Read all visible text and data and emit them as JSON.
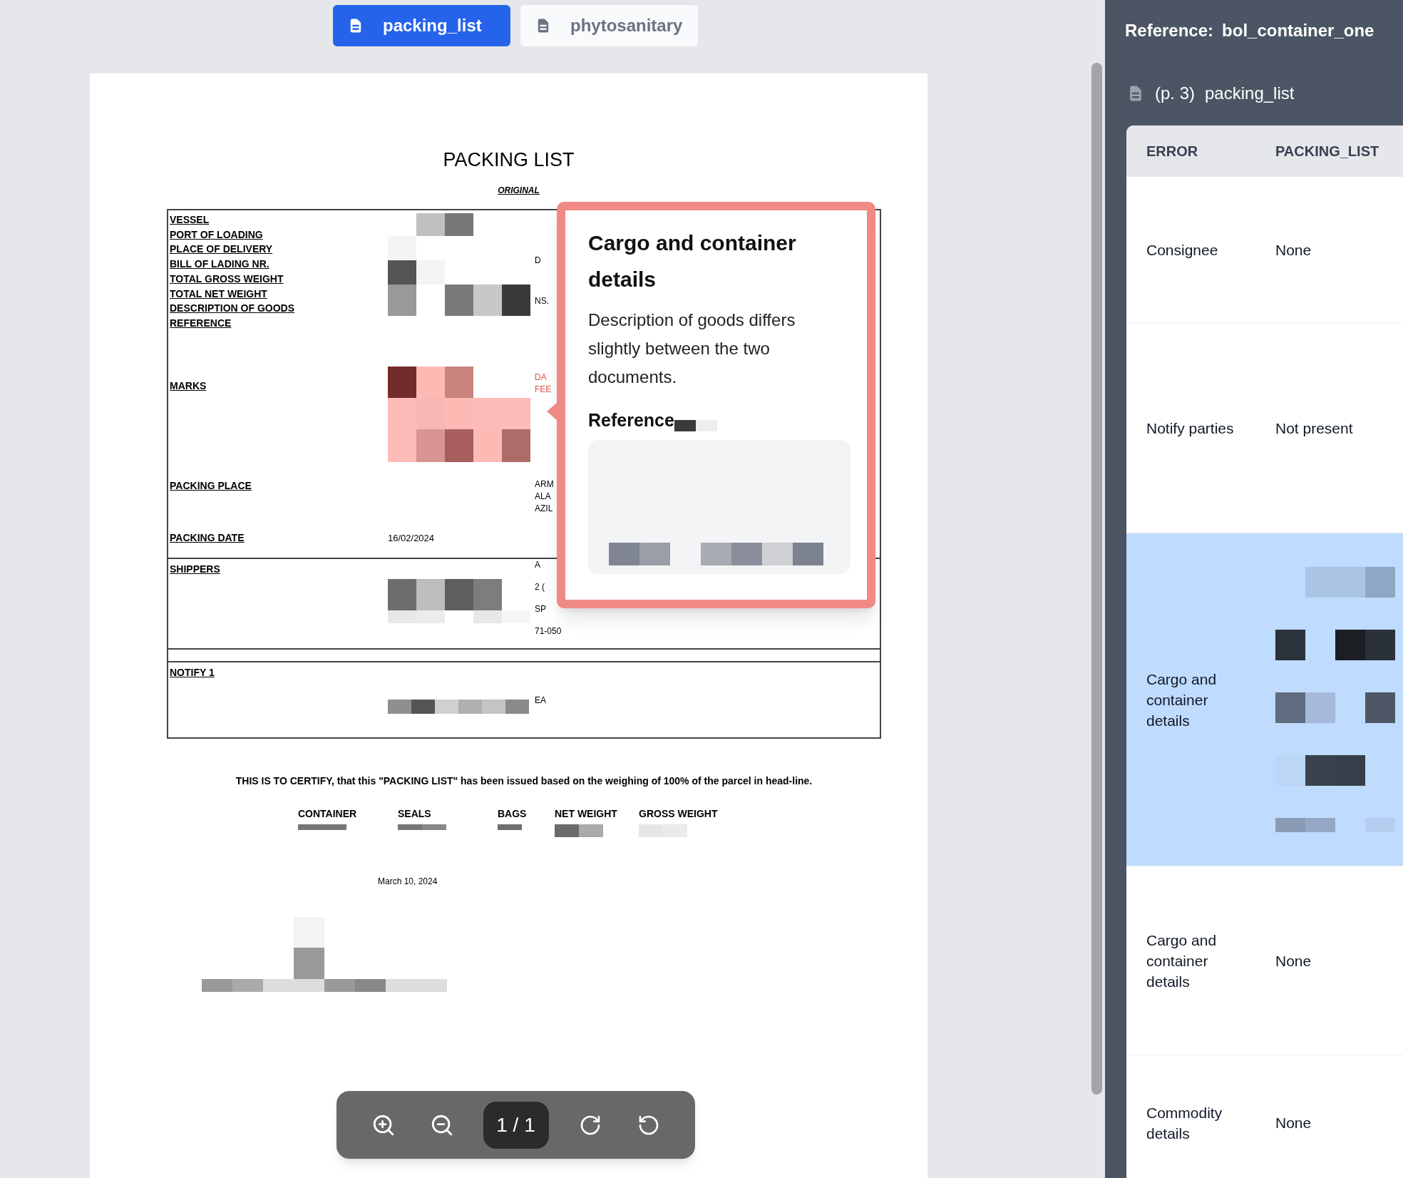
{
  "tabs": [
    {
      "label": "packing_list",
      "selected": true
    },
    {
      "label": "phytosanitary",
      "selected": false
    }
  ],
  "document": {
    "title": "PACKING LIST",
    "subtitle": "ORIGINAL",
    "sections": [
      {
        "fields": [
          {
            "label": "VESSEL"
          },
          {
            "label": "PORT OF LOADING"
          },
          {
            "label": "PLACE OF DELIVERY"
          },
          {
            "label": "BILL OF LADING NR."
          },
          {
            "label": "TOTAL GROSS WEIGHT"
          },
          {
            "label": "TOTAL NET WEIGHT"
          },
          {
            "label": "DESCRIPTION OF GOODS"
          },
          {
            "label": "REFERENCE"
          }
        ],
        "edge_texts": [
          "D",
          "NS."
        ],
        "highlighted": false
      },
      {
        "fields": [
          {
            "label": "MARKS"
          }
        ],
        "edge_texts": [
          "DA",
          "FEE"
        ],
        "highlighted": true
      },
      {
        "fields": [
          {
            "label": "PACKING PLACE"
          }
        ],
        "edge_texts": [
          "ARM",
          "ALA",
          "AZIL"
        ],
        "highlighted": false
      },
      {
        "fields": [
          {
            "label": "PACKING DATE",
            "value": "16/02/2024"
          }
        ],
        "highlighted": false
      },
      {
        "fields": [
          {
            "label": "SHIPPERS"
          }
        ],
        "edge_texts": [
          "A",
          "2 (",
          "SP",
          "71-050"
        ],
        "highlighted": false
      },
      {
        "fields": [
          {
            "label": "NOTIFY 1"
          }
        ],
        "edge_texts": [
          "EA"
        ],
        "highlighted": false
      }
    ],
    "certification": "THIS IS TO CERTIFY, that this \"PACKING LIST\" has been issued based on the weighing of 100% of the parcel in head-line.",
    "summary_columns": [
      "CONTAINER",
      "SEALS",
      "BAGS",
      "NET WEIGHT",
      "GROSS WEIGHT"
    ],
    "date": "March 10, 2024"
  },
  "popover": {
    "title": "Cargo and container details",
    "message": "Description of goods differs slightly between the two documents.",
    "reference_label": "Reference"
  },
  "toolbar": {
    "buttons": [
      {
        "kind": "zoom_in"
      },
      {
        "kind": "zoom_out"
      },
      {
        "kind": "page",
        "label": "1 / 1"
      },
      {
        "kind": "rotate_cw"
      },
      {
        "kind": "rotate_ccw"
      }
    ]
  },
  "panel": {
    "reference_label": "Reference:",
    "reference_value": "bol_container_one",
    "page": "(p. 3)",
    "document": "packing_list",
    "columns": [
      "ERROR",
      "PACKING_LIST"
    ],
    "rows": [
      {
        "error": "Consignee",
        "value": "None",
        "selected": false
      },
      {
        "error": "Notify parties",
        "value": "Not present",
        "selected": false
      },
      {
        "error": "Cargo and container details",
        "selected": true
      },
      {
        "error": "Cargo and container details",
        "value": "None",
        "selected": false
      },
      {
        "error": "Commodity details",
        "value": "None",
        "selected": false
      }
    ]
  }
}
